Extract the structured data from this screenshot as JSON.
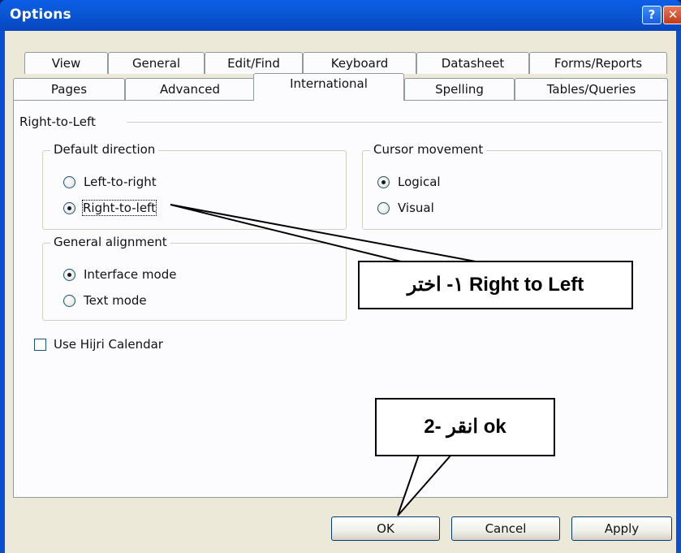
{
  "window": {
    "title": "Options",
    "help_label": "?",
    "close_label": "✕"
  },
  "tabs": {
    "row1": [
      "View",
      "General",
      "Edit/Find",
      "Keyboard",
      "Datasheet",
      "Forms/Reports"
    ],
    "row2": [
      "Pages",
      "Advanced",
      "International",
      "Spelling",
      "Tables/Queries"
    ],
    "active": "International"
  },
  "rtl_section": {
    "label": "Right-to-Left"
  },
  "default_direction": {
    "legend": "Default direction",
    "options": [
      {
        "label": "Left-to-right",
        "checked": false
      },
      {
        "label": "Right-to-left",
        "checked": true
      }
    ]
  },
  "cursor_movement": {
    "legend": "Cursor movement",
    "options": [
      {
        "label": "Logical",
        "checked": true
      },
      {
        "label": "Visual",
        "checked": false
      }
    ]
  },
  "general_alignment": {
    "legend": "General alignment",
    "options": [
      {
        "label": "Interface mode",
        "checked": true
      },
      {
        "label": "Text mode",
        "checked": false
      }
    ]
  },
  "hijri": {
    "label": "Use Hijri Calendar",
    "checked": false
  },
  "buttons": {
    "ok": "OK",
    "cancel": "Cancel",
    "apply": "Apply"
  },
  "callouts": {
    "step1": "١- اختر Right to Left",
    "step2": "2- انقر ok"
  },
  "colors": {
    "titlebar": "#0a57d6",
    "dialog_bg": "#ece9d8",
    "panel_bg": "#fcfcfe"
  }
}
